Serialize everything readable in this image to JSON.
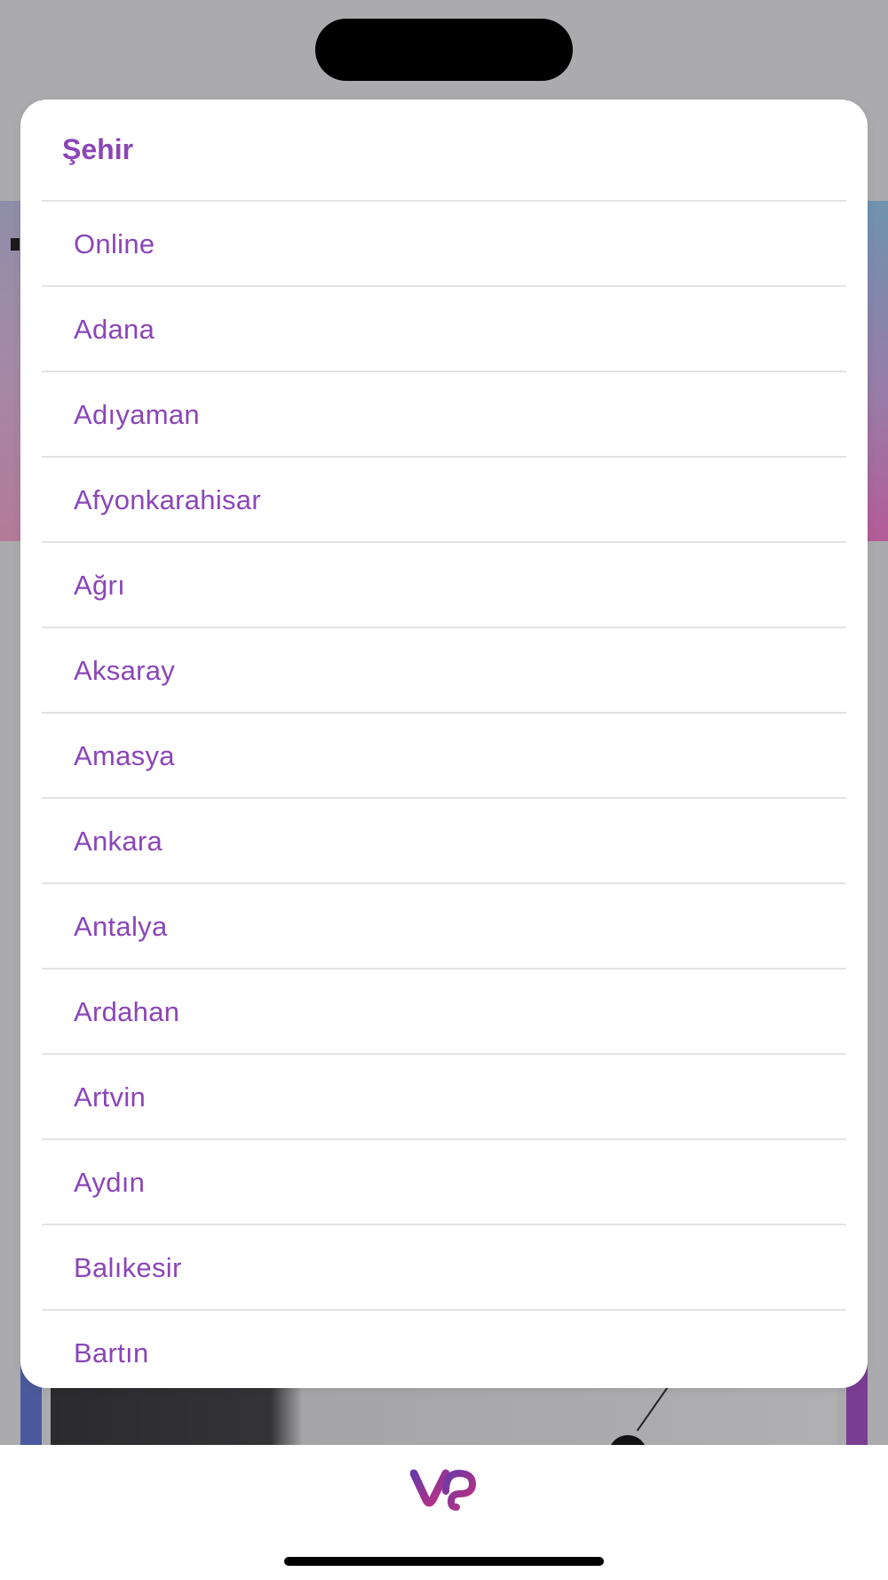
{
  "picker": {
    "title": "Şehir",
    "items": [
      {
        "label": "Online"
      },
      {
        "label": "Adana"
      },
      {
        "label": "Adıyaman"
      },
      {
        "label": "Afyonkarahisar"
      },
      {
        "label": "Ağrı"
      },
      {
        "label": "Aksaray"
      },
      {
        "label": "Amasya"
      },
      {
        "label": "Ankara"
      },
      {
        "label": "Antalya"
      },
      {
        "label": "Ardahan"
      },
      {
        "label": "Artvin"
      },
      {
        "label": "Aydın"
      },
      {
        "label": "Balıkesir"
      },
      {
        "label": "Bartın"
      }
    ]
  },
  "colors": {
    "accent": "#8a46b8",
    "divider": "#e3e3e6",
    "overlay": "#ababad"
  },
  "icons": {
    "logo": "vp-logo-icon"
  }
}
